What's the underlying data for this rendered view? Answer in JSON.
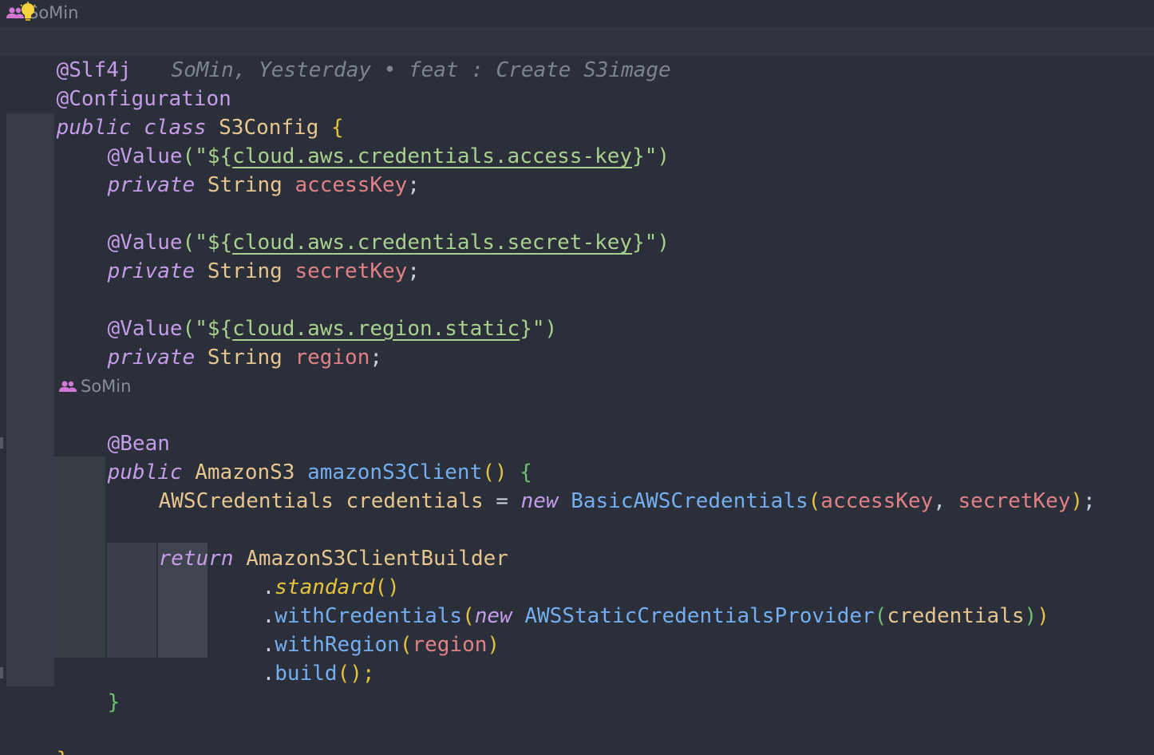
{
  "top_hint": {
    "author": "SoMin"
  },
  "blame": {
    "text": "SoMin, Yesterday • feat : Create S3image"
  },
  "method_hint": {
    "author": "SoMin"
  },
  "code": {
    "l1_ann": "@Slf4j",
    "l2_ann": "@Configuration",
    "l3_kw1": "public",
    "l3_kw2": "class",
    "l3_name": "S3Config",
    "l3_brace": "{",
    "value_ann": "@Value",
    "open_quote": "(\"${",
    "close_quote": "}\")",
    "p1": "cloud.aws.credentials.access-key",
    "p2": "cloud.aws.credentials.secret-key",
    "p3": "cloud.aws.region.static",
    "private_kw": "private",
    "string_type": "String",
    "f1": "accessKey",
    "f2": "secretKey",
    "f3": "region",
    "semi": ";",
    "bean_ann": "@Bean",
    "m_kw": "public",
    "m_type": "AmazonS3",
    "m_name": "amazonS3Client",
    "m_parens": "()",
    "m_brace": "{",
    "c_type": "AWSCredentials",
    "c_var": "credentials",
    "c_eq": "=",
    "c_new": "new",
    "c_cls": "BasicAWSCredentials",
    "c_open": "(",
    "c_arg1": "accessKey",
    "c_comma": ",",
    "c_arg2": "secretKey",
    "c_close": ")",
    "ret_kw": "return",
    "ret_cls": "AmazonS3ClientBuilder",
    "dot": ".",
    "b1": "standard",
    "b1_parens": "()",
    "b2": "withCredentials",
    "b2_new": "new",
    "b2_cls": "AWSStaticCredentialsProvider",
    "b2_arg": "credentials",
    "b3": "withRegion",
    "b3_arg": "region",
    "b4": "build",
    "b4_tail": "();",
    "m_close": "}",
    "class_close": "}"
  }
}
